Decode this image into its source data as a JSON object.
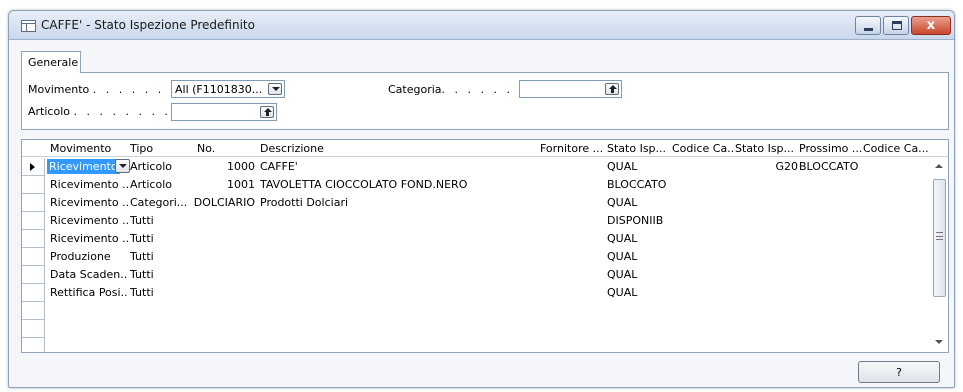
{
  "window": {
    "title": "CAFFE' - Stato Ispezione Predefinito",
    "close_glyph": "x"
  },
  "tabs": [
    {
      "label": "Generale"
    }
  ],
  "filters": {
    "movimento_label": "Movimento",
    "movimento_dots": ". . . . . . .",
    "movimento_value": "All (F1101830...",
    "categoria_label": "Categoria",
    "categoria_dots": ". . . . . . . .",
    "categoria_value": "",
    "articolo_label": "Articolo",
    "articolo_dots": ". . . . . . . . .",
    "articolo_value": ""
  },
  "grid": {
    "columns": [
      "Movimento",
      "Tipo",
      "No.",
      "Descrizione",
      "Fornitore ...",
      "Stato Isp...",
      "Codice Ca...",
      "Stato Isp...",
      "Prossimo ...",
      "Codice Ca..."
    ],
    "rows": [
      {
        "movimento": "Ricevimento",
        "tipo": "Articolo",
        "no": "1000",
        "descrizione": "CAFFE'",
        "fornitore": "",
        "stato": "QUAL",
        "codice1": "",
        "stato2": "G20",
        "prossimo": "BLOCCATO",
        "codice2": ""
      },
      {
        "movimento": "Ricevimento ...",
        "tipo": "Articolo",
        "no": "1001",
        "descrizione": "TAVOLETTA CIOCCOLATO FOND.NERO",
        "fornitore": "",
        "stato": "BLOCCATO",
        "codice1": "",
        "stato2": "",
        "prossimo": "",
        "codice2": ""
      },
      {
        "movimento": "Ricevimento ...",
        "tipo": "Categori...",
        "no": "DOLCIARIO",
        "descrizione": "Prodotti Dolciari",
        "fornitore": "",
        "stato": "QUAL",
        "codice1": "",
        "stato2": "",
        "prossimo": "",
        "codice2": ""
      },
      {
        "movimento": "Ricevimento ...",
        "tipo": "Tutti",
        "no": "",
        "descrizione": "",
        "fornitore": "",
        "stato": "DISPONIIB",
        "codice1": "",
        "stato2": "",
        "prossimo": "",
        "codice2": ""
      },
      {
        "movimento": "Ricevimento ...",
        "tipo": "Tutti",
        "no": "",
        "descrizione": "",
        "fornitore": "",
        "stato": "QUAL",
        "codice1": "",
        "stato2": "",
        "prossimo": "",
        "codice2": ""
      },
      {
        "movimento": "Produzione",
        "tipo": "Tutti",
        "no": "",
        "descrizione": "",
        "fornitore": "",
        "stato": "QUAL",
        "codice1": "",
        "stato2": "",
        "prossimo": "",
        "codice2": ""
      },
      {
        "movimento": "Data Scaden...",
        "tipo": "Tutti",
        "no": "",
        "descrizione": "",
        "fornitore": "",
        "stato": "QUAL",
        "codice1": "",
        "stato2": "",
        "prossimo": "",
        "codice2": ""
      },
      {
        "movimento": "Rettifica Posi...",
        "tipo": "Tutti",
        "no": "",
        "descrizione": "",
        "fornitore": "",
        "stato": "QUAL",
        "codice1": "",
        "stato2": "",
        "prossimo": "",
        "codice2": ""
      }
    ],
    "empty_rows": 3
  },
  "footer": {
    "help_label": "?"
  },
  "colors": {
    "selection": "#3399ff",
    "close_button": "#c9462d",
    "border": "#8ea2bd"
  }
}
